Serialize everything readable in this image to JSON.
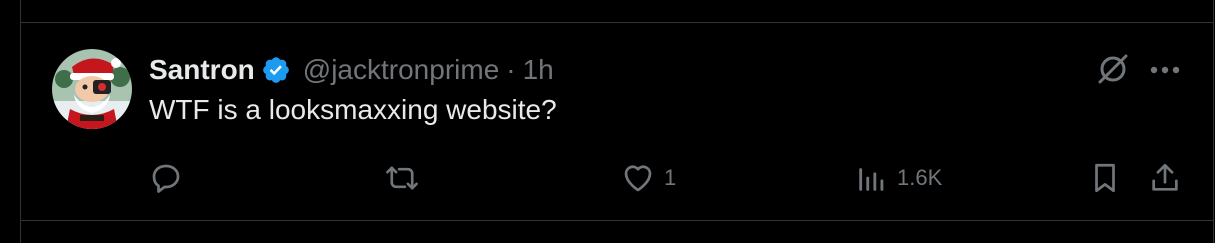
{
  "tweet": {
    "author_name": "Santron",
    "verified": true,
    "handle": "@jacktronprime",
    "separator": "·",
    "time": "1h",
    "text": "WTF is a looksmaxxing website?"
  },
  "actions": {
    "reply": {
      "icon": "reply-icon",
      "count": ""
    },
    "repost": {
      "icon": "repost-icon",
      "count": ""
    },
    "like": {
      "icon": "heart-icon",
      "count": "1"
    },
    "views": {
      "icon": "views-icon",
      "count": "1.6K"
    },
    "bookmark": {
      "icon": "bookmark-icon"
    },
    "share": {
      "icon": "share-icon"
    }
  },
  "header_actions": {
    "grok": {
      "icon": "grok-icon"
    },
    "more": {
      "icon": "more-icon"
    }
  },
  "colors": {
    "background": "#000000",
    "text_primary": "#e7e9ea",
    "text_secondary": "#71767b",
    "divider": "#2f3336",
    "verified_blue": "#1d9bf0"
  }
}
